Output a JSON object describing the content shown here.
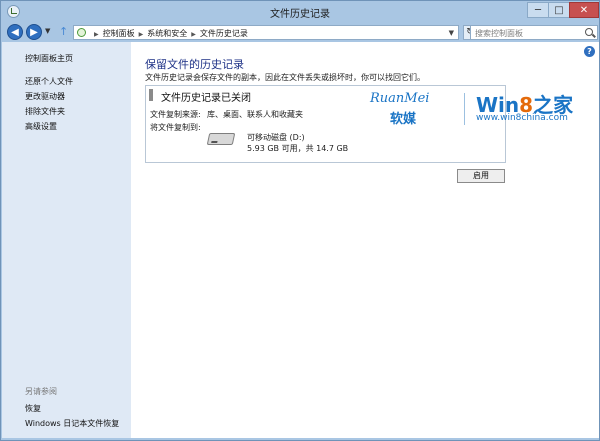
{
  "window": {
    "title": "文件历史记录",
    "controls": {
      "minimize": "─",
      "maximize": "□",
      "close": "✕"
    }
  },
  "nav": {
    "back": "◀",
    "forward": "▶",
    "history_dropdown": "▼",
    "up": "↑",
    "breadcrumb": [
      "控制面板",
      "系统和安全",
      "文件历史记录"
    ],
    "crumb_separator": "▶",
    "address_dropdown": "▼",
    "refresh": "↻",
    "search_placeholder": "搜索控制面板"
  },
  "sidebar": {
    "home": "控制面板主页",
    "links": [
      "还原个人文件",
      "更改驱动器",
      "排除文件夹",
      "高级设置"
    ],
    "see_also": "另请参阅",
    "bottom_links": [
      "恢复",
      "Windows 日记本文件恢复"
    ]
  },
  "main": {
    "help": "?",
    "heading": "保留文件的历史记录",
    "description": "文件历史记录会保存文件的副本，因此在文件丢失或损坏时，你可以找回它们。",
    "panel": {
      "title": "文件历史记录已关闭",
      "source_label": "文件复制来源:",
      "source_value": "库、桌面、联系人和收藏夹",
      "dest_label": "将文件复制到:",
      "drive_name": "可移动磁盘 (D:)",
      "drive_size": "5.93 GB 可用，共 14.7 GB"
    },
    "enable_button": "启用"
  },
  "watermark": {
    "ruanmei": "RuanMei",
    "ruanmei_cn": "软媒",
    "win": "Win",
    "eight": "8",
    "zhijia": "之家",
    "site": "www.win8china.com"
  },
  "colors": {
    "accent": "#1e3287",
    "chrome": "#a9c6e3",
    "sidebar": "#dfe9f5",
    "logo_blue": "#1a74c5",
    "logo_orange": "#e46a0b"
  }
}
